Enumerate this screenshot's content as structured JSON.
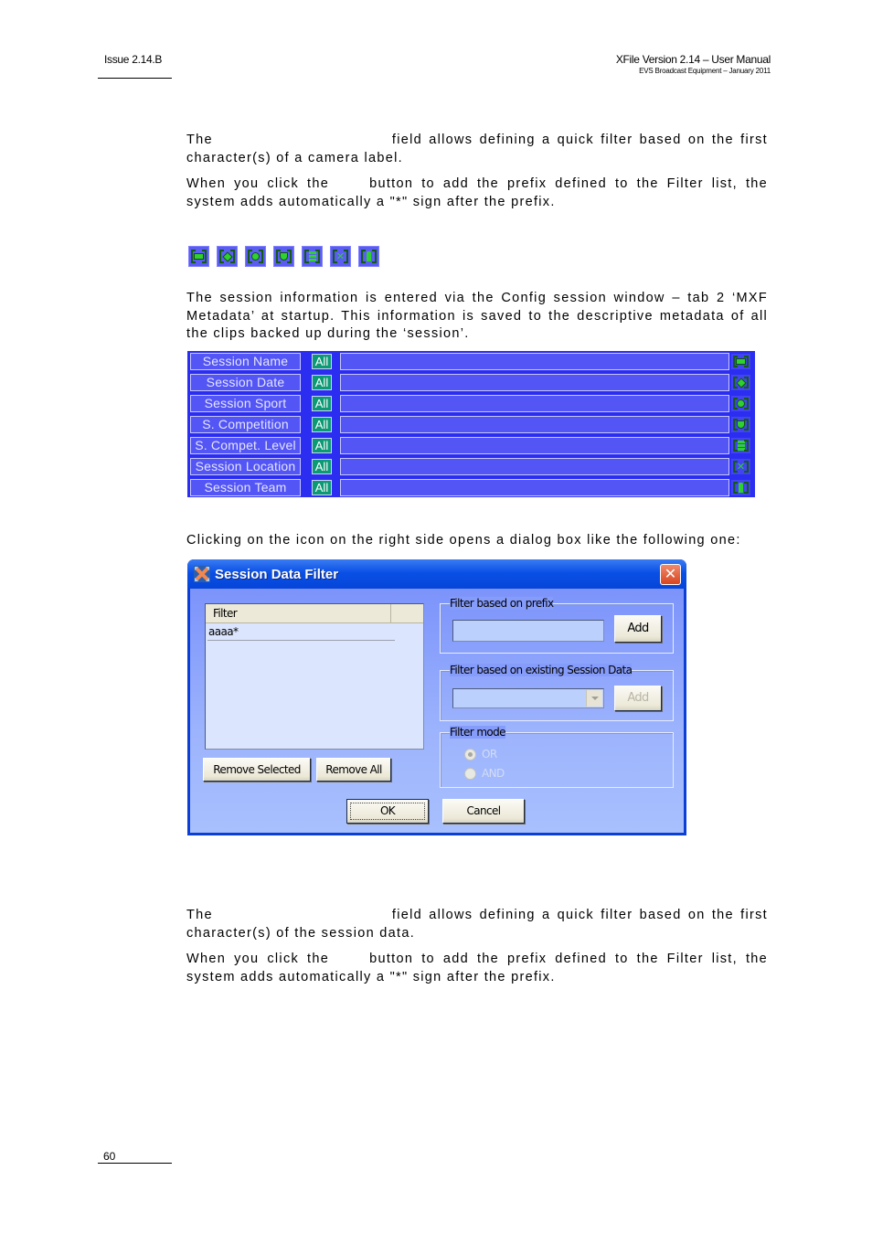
{
  "header": {
    "issue": "Issue 2.14.B",
    "title": "XFile Version 2.14 – User Manual",
    "subtitle": "EVS Broadcast Equipment – January 2011"
  },
  "paragraphs": {
    "p1_a": "The",
    "p1_b": "field allows defining a quick filter based on the first character(s) of a camera label.",
    "p2_a": "When you click the",
    "p2_b": "button to add the prefix defined to the Filter list, the system adds automatically a \"*\" sign after the prefix.",
    "p3": "The session information is entered via the Config session window – tab 2 ‘MXF Metadata’ at startup. This information is saved to the descriptive metadata of all the clips backed up during the ‘session’.",
    "p4": "Clicking on the icon on the right side opens a dialog box like the following one:",
    "p5_a": "The",
    "p5_b": "field allows defining a quick filter based on the first character(s) of the session data.",
    "p6_a": "When you click the",
    "p6_b": "button to add the prefix defined to the Filter list, the system adds automatically a \"*\" sign after the prefix."
  },
  "icon_row": [
    {
      "icon": "session-name-icon"
    },
    {
      "icon": "session-date-icon"
    },
    {
      "icon": "session-sport-icon"
    },
    {
      "icon": "session-competition-icon"
    },
    {
      "icon": "session-compet-level-icon"
    },
    {
      "icon": "session-location-icon"
    },
    {
      "icon": "session-team-icon"
    }
  ],
  "session_panel": {
    "rows": [
      {
        "label": "Session Name",
        "all": "All",
        "value": "",
        "icon": "session-name-icon"
      },
      {
        "label": "Session Date",
        "all": "All",
        "value": "",
        "icon": "session-date-icon"
      },
      {
        "label": "Session Sport",
        "all": "All",
        "value": "",
        "icon": "session-sport-icon"
      },
      {
        "label": "S. Competition",
        "all": "All",
        "value": "",
        "icon": "session-competition-icon"
      },
      {
        "label": "S. Compet. Level",
        "all": "All",
        "value": "",
        "icon": "session-compet-level-icon"
      },
      {
        "label": "Session Location",
        "all": "All",
        "value": "",
        "icon": "session-location-icon"
      },
      {
        "label": "Session Team",
        "all": "All",
        "value": "",
        "icon": "session-team-icon"
      }
    ],
    "colors": {
      "panel": "#2b2ef0",
      "field": "#5355f4",
      "all_button": "#0c9a74",
      "icon_glyph": "#2fd02f"
    }
  },
  "dialog": {
    "title": "Session Data Filter",
    "close_symbol": "✕",
    "filter_list": {
      "column_header": "Filter",
      "items": [
        "aaaa*"
      ]
    },
    "remove_selected_label": "Remove Selected",
    "remove_all_label": "Remove All",
    "prefix_group": {
      "legend": "Filter based on prefix",
      "input_value": "",
      "add_label": "Add"
    },
    "existing_group": {
      "legend": "Filter based on existing Session Data",
      "selected_value": "",
      "add_label": "Add"
    },
    "mode_group": {
      "legend": "Filter mode",
      "options": [
        {
          "label": "OR",
          "selected": true
        },
        {
          "label": "AND",
          "selected": false
        }
      ]
    },
    "ok_label": "OK",
    "cancel_label": "Cancel"
  },
  "footer": {
    "page_number": "60"
  }
}
